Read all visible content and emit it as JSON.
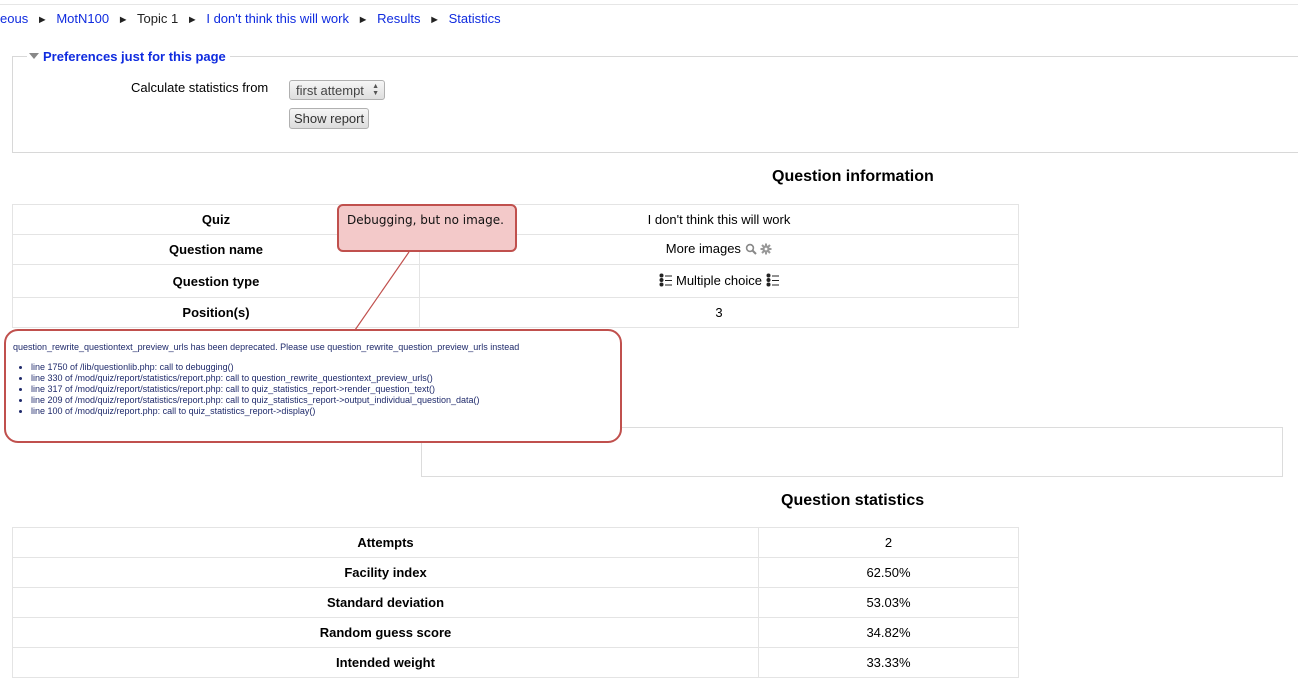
{
  "breadcrumb": {
    "items": [
      "eous",
      "MotN100",
      "Topic 1",
      "I don't think this will work",
      "Results",
      "Statistics"
    ],
    "separator": "►"
  },
  "preferences": {
    "legend": "Preferences just for this page",
    "calc_label": "Calculate statistics from",
    "calc_value": "first attempt",
    "show_button": "Show report"
  },
  "question_info": {
    "heading": "Question information",
    "rows": [
      {
        "key": "Quiz",
        "value": "I don't think this will work"
      },
      {
        "key": "Question name",
        "value": "More images"
      },
      {
        "key": "Question type",
        "value": "Multiple choice"
      },
      {
        "key": "Position(s)",
        "value": "3"
      }
    ]
  },
  "callout": {
    "text": "Debugging, but no image."
  },
  "debug": {
    "message": "question_rewrite_questiontext_preview_urls has been deprecated. Please use question_rewrite_question_preview_urls instead",
    "lines": [
      "line 1750 of /lib/questionlib.php: call to debugging()",
      "line 330 of /mod/quiz/report/statistics/report.php: call to question_rewrite_questiontext_preview_urls()",
      "line 317 of /mod/quiz/report/statistics/report.php: call to quiz_statistics_report->render_question_text()",
      "line 209 of /mod/quiz/report/statistics/report.php: call to quiz_statistics_report->output_individual_question_data()",
      "line 100 of /mod/quiz/report.php: call to quiz_statistics_report->display()"
    ]
  },
  "question_stats": {
    "heading": "Question statistics",
    "rows": [
      {
        "key": "Attempts",
        "value": "2"
      },
      {
        "key": "Facility index",
        "value": "62.50%"
      },
      {
        "key": "Standard deviation",
        "value": "53.03%"
      },
      {
        "key": "Random guess score",
        "value": "34.82%"
      },
      {
        "key": "Intended weight",
        "value": "33.33%"
      }
    ]
  },
  "colors": {
    "link": "#0f2bdf",
    "callout_border": "#c0504d",
    "callout_fill": "#f3c9c9"
  },
  "icons": {
    "preview": "search-icon",
    "edit": "gear-icon",
    "qtype": "multichoice-icon"
  }
}
